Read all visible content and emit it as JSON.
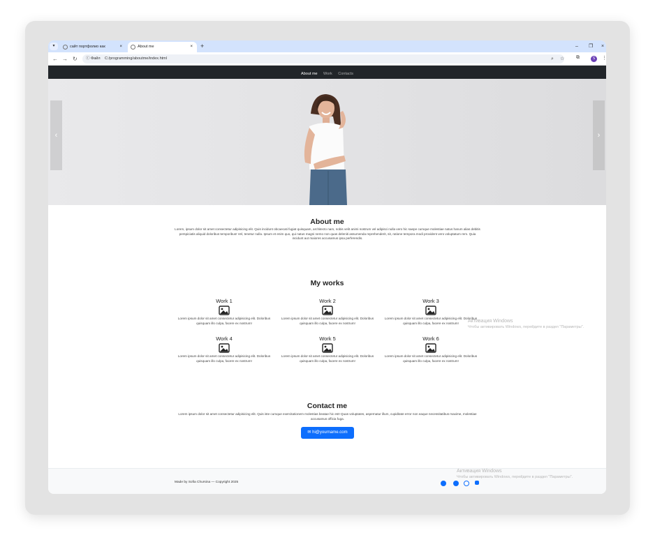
{
  "browser": {
    "tabs": [
      {
        "title": "сайт портфолио как сверстать...",
        "active": false
      },
      {
        "title": "About me",
        "active": true
      }
    ],
    "new_tab": "+",
    "address": {
      "security_label": "Файл",
      "url": "C:/programming/aboutme/index.html"
    },
    "window_controls": {
      "minimize": "–",
      "restore": "❐",
      "close": "×"
    }
  },
  "navbar": {
    "items": [
      {
        "label": "About me",
        "active": true
      },
      {
        "label": "Work",
        "active": false
      },
      {
        "label": "Contacts",
        "active": false
      }
    ]
  },
  "carousel": {
    "prev": "‹",
    "next": "›"
  },
  "about": {
    "title": "About me",
    "text": "Lorem, ipsum dolor sit amet consectetur adipisicing elit. Quis incidunt obcaecati fugiat quisquam, architecto nam, nobis velit animi nostrum vel adipisci nulla vero hic saepe cumque molestiae natus harum alias debitis perspiciatis aliquid doloribus temporibus! Vel, tenetur nulla. Ipsum et enim quo, qui natus magni nemo non quas deleniti assumenda reprehenderit, sit, ratione tempora modi provident vero voluptatum rem. Quia incidunt aut maiores accusamus ipsa perferendis."
  },
  "works": {
    "title": "My works",
    "items": [
      {
        "title": "Work 1",
        "text": "Lorem ipsum dolor sit amet consectetur adipisicing elit. Doloribus quisquam illo culpa, facere ex nostrum!"
      },
      {
        "title": "Work 2",
        "text": "Lorem ipsum dolor sit amet consectetur adipisicing elit. Doloribus quisquam illo culpa, facere ex nostrum!"
      },
      {
        "title": "Work 3",
        "text": "Lorem ipsum dolor sit amet consectetur adipisicing elit. Doloribus quisquam illo culpa, facere ex nostrum!"
      },
      {
        "title": "Work 4",
        "text": "Lorem ipsum dolor sit amet consectetur adipisicing elit. Doloribus quisquam illo culpa, facere ex nostrum!"
      },
      {
        "title": "Work 5",
        "text": "Lorem ipsum dolor sit amet consectetur adipisicing elit. Doloribus quisquam illo culpa, facere ex nostrum!"
      },
      {
        "title": "Work 6",
        "text": "Lorem ipsum dolor sit amet consectetur adipisicing elit. Doloribus quisquam illo culpa, facere ex nostrum!"
      }
    ]
  },
  "contact": {
    "title": "Contact me",
    "text": "Lorem ipsum dolor sit amet consectetur adipisicing elit. Quis iste cumque exercitationem molestias beatae hic est! Quas voluptates, aspernatur illum, cupiditate error non eaque necessitatibus maxime, molestiae accusamus officia fuga.",
    "email": "hi@yourname.com"
  },
  "footer": {
    "copyright": "Made by Sofia Chursina — Copyright 2025",
    "social_icons": [
      "telegram-icon",
      "facebook-icon",
      "whatsapp-icon",
      "twitter-icon"
    ]
  },
  "watermark": {
    "title": "Активация Windows",
    "text": "Чтобы активировать Windows, перейдите в раздел \"Параметры\"."
  },
  "colors": {
    "navbar": "#212529",
    "primary": "#0d6efd",
    "footer": "#f8f9fa"
  }
}
